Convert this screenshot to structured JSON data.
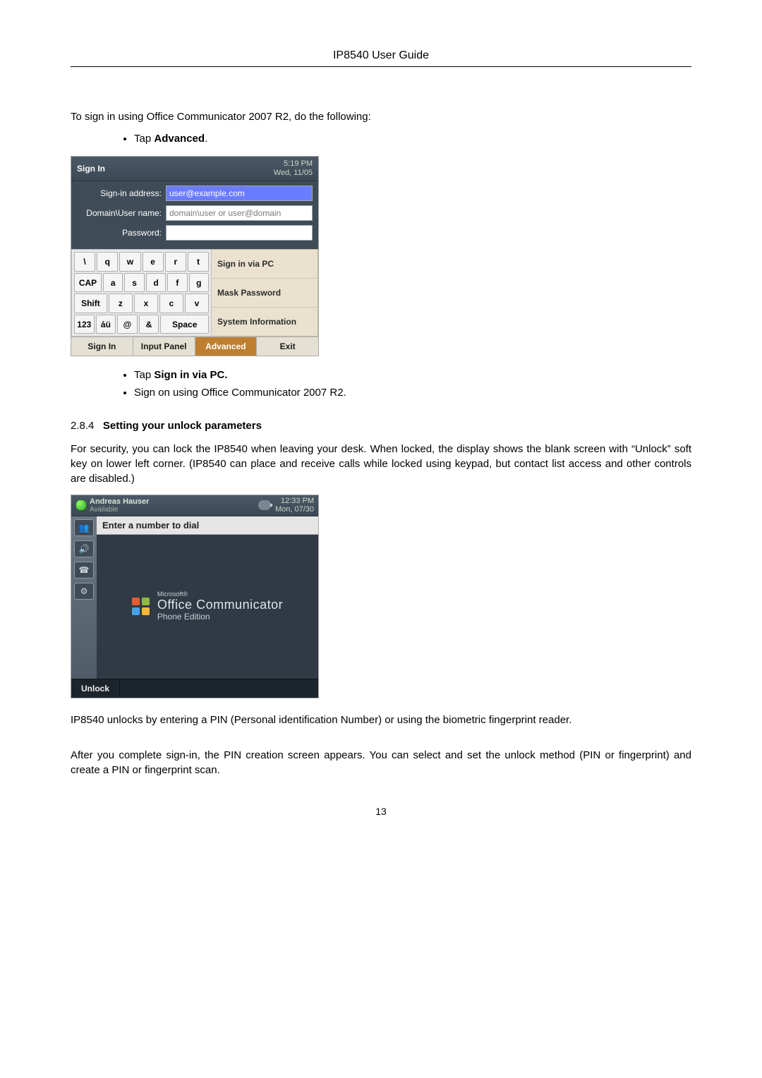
{
  "header": {
    "title": "IP8540 User Guide"
  },
  "intro": "To sign in using Office Communicator 2007 R2, do the following:",
  "bullets_top": [
    {
      "prefix": "Tap ",
      "bold": "Advanced",
      "suffix": "."
    }
  ],
  "signin": {
    "title": "Sign In",
    "time": "5:19 PM",
    "date": "Wed, 11/05",
    "rows": {
      "signin_label": "Sign-in address:",
      "signin_value": "user@example.com",
      "domain_label": "Domain\\User name:",
      "domain_value": "domain\\user or user@domain",
      "password_label": "Password:",
      "password_value": "*************"
    },
    "keyboard": [
      [
        "\\",
        "q",
        "w",
        "e",
        "r",
        "t"
      ],
      [
        "CAP",
        "a",
        "s",
        "d",
        "f",
        "g"
      ],
      [
        "Shift",
        "z",
        "x",
        "c",
        "v"
      ],
      [
        "123",
        "áü",
        "@",
        "&",
        "Space"
      ]
    ],
    "sidemenu": [
      "Sign in via PC",
      "Mask Password",
      "System Information"
    ],
    "bottombar": [
      "Sign In",
      "Input Panel",
      "Advanced",
      "Exit"
    ],
    "active_bottom": "Advanced"
  },
  "bullets_mid": [
    {
      "prefix": "Tap ",
      "bold": "Sign in via PC.",
      "suffix": ""
    },
    {
      "prefix": "Sign on using Office Communicator 2007 R2.",
      "bold": "",
      "suffix": ""
    }
  ],
  "section": {
    "num": "2.8.4",
    "title": "Setting your unlock parameters"
  },
  "para1": "For security, you can lock the IP8540 when leaving your desk. When locked, the display shows the blank screen with “Unlock” soft key on lower left corner. (IP8540 can place and receive calls while locked using keypad, but contact list access and other controls are disabled.)",
  "lock": {
    "user": "Andreas Hauser",
    "status": "Available",
    "time": "12:33 PM",
    "date": "Mon, 07/30",
    "dialbar": "Enter a number to dial",
    "brand_small": "Microsoft®",
    "brand_big": "Office Communicator",
    "brand_sub": "Phone Edition",
    "unlock": "Unlock"
  },
  "para2": "IP8540 unlocks by entering a PIN (Personal identification Number) or using the biometric fingerprint reader.",
  "para3": "After you complete sign-in, the PIN creation screen appears.  You can select and set the unlock method (PIN or fingerprint) and create a PIN or fingerprint scan.",
  "pagenum": "13"
}
